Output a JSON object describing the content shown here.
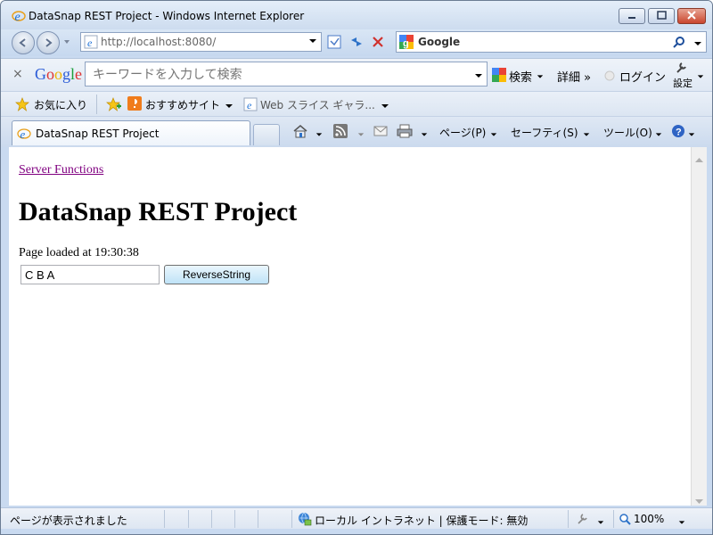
{
  "window": {
    "title": "DataSnap REST Project - Windows Internet Explorer"
  },
  "navbar": {
    "address_host": "http://localhost",
    "address_port": ":8080/",
    "search_placeholder": "Google"
  },
  "google_toolbar": {
    "logo": "Google",
    "search_placeholder": "キーワードを入力して検索",
    "search_button": "検索",
    "more_label": "詳細 »",
    "login_label": "ログイン",
    "settings_label": "設定"
  },
  "favorites": {
    "favorites_label": "お気に入り",
    "suggested_sites": "おすすめサイト",
    "web_slices": "Web スライス ギャラ..."
  },
  "tabs": {
    "active_tab": "DataSnap REST Project"
  },
  "command_bar": {
    "page": "ページ(P)",
    "safety": "セーフティ(S)",
    "tools": "ツール(O)"
  },
  "page": {
    "link_text": "Server Functions",
    "heading": "DataSnap REST Project",
    "loaded_text": "Page loaded at 19:30:38",
    "input_value": "C B A",
    "button_label": "ReverseString"
  },
  "statusbar": {
    "status_message": "ページが表示されました",
    "zone": "ローカル イントラネット | 保護モード: 無効",
    "zoom": "100%"
  },
  "colors": {
    "visited_link": "#800080",
    "chrome_blue": "#c9daf0"
  }
}
